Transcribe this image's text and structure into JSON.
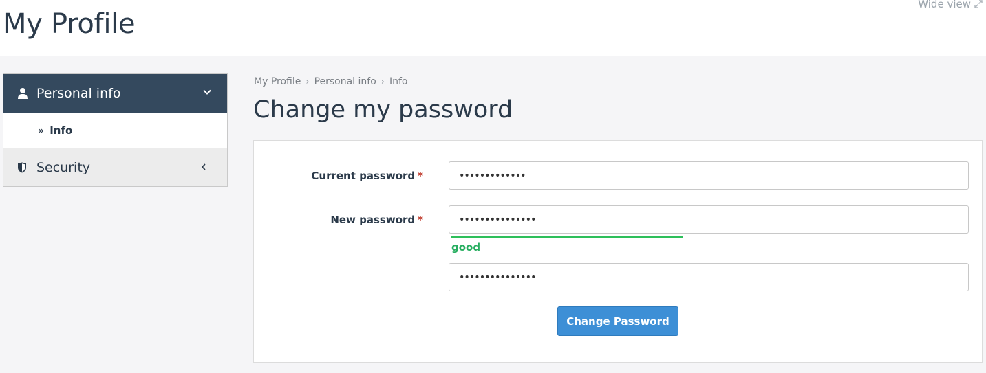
{
  "header": {
    "title": "My Profile",
    "wide_view": "Wide view"
  },
  "sidebar": {
    "personal": {
      "label": "Personal info",
      "icon": "user-icon",
      "items": [
        {
          "label": "Info"
        }
      ]
    },
    "security": {
      "label": "Security",
      "icon": "shield-icon"
    }
  },
  "breadcrumb": [
    "My Profile",
    "Personal info",
    "Info"
  ],
  "form": {
    "title": "Change my password",
    "current_password_label": "Current password",
    "current_password_value": "•••••••••••••",
    "new_password_label": "New password",
    "new_password_value": "•••••••••••••••",
    "required_marker": "*",
    "confirm_password_value": "•••••••••••••••",
    "strength_label": "good",
    "strength_color": "#2ebf5a",
    "submit_label": "Change Password"
  },
  "colors": {
    "sidebar_active_bg": "#34495e",
    "button_bg": "#3d8fd6",
    "required": "#c0392b"
  }
}
